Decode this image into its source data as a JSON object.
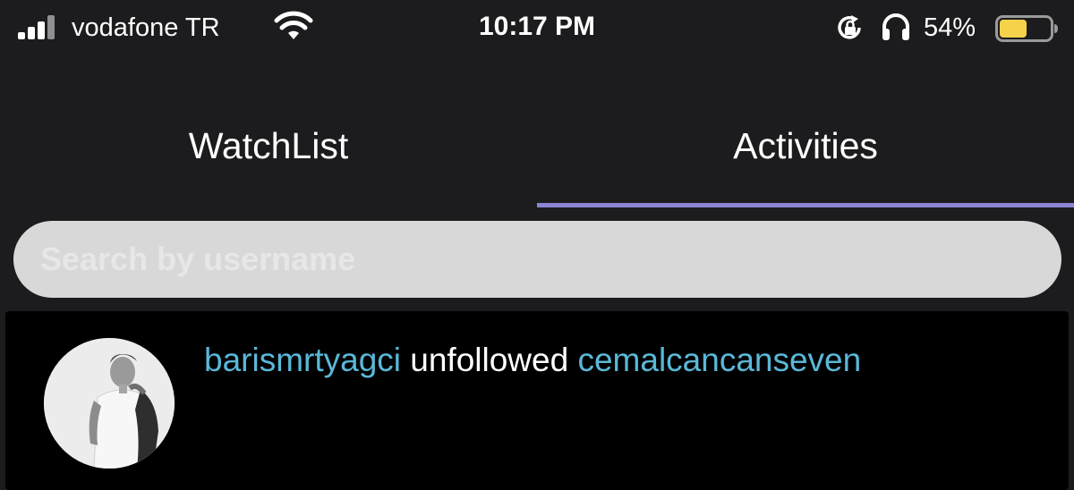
{
  "status_bar": {
    "carrier": "vodafone TR",
    "time": "10:17 PM",
    "battery_percent": "54%",
    "battery_level": 0.54,
    "battery_color": "#f5d24a",
    "signal_bars": 4,
    "icons": [
      "signal-icon",
      "wifi-icon",
      "rotation-lock-icon",
      "headphones-icon",
      "battery-icon"
    ]
  },
  "tabs": [
    {
      "label": "WatchList",
      "active": false
    },
    {
      "label": "Activities",
      "active": true
    }
  ],
  "tab_indicator_color": "#8b85d3",
  "search": {
    "placeholder": "Search by username",
    "value": ""
  },
  "activities": [
    {
      "actor": "barismrtyagci",
      "action": "unfollowed",
      "target": "cemalcancanseven",
      "link_color": "#5ab8d8"
    }
  ]
}
